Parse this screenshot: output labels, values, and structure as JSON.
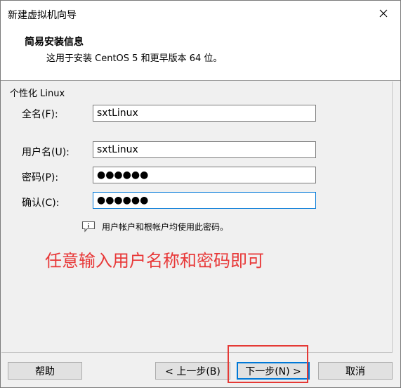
{
  "window": {
    "title": "新建虚拟机向导"
  },
  "header": {
    "title": "简易安装信息",
    "subtitle": "这用于安装 CentOS 5 和更早版本 64 位。"
  },
  "form": {
    "group_label": "个性化 Linux",
    "full_name": {
      "label": "全名(F):",
      "value": "sxtLinux"
    },
    "username": {
      "label": "用户名(U):",
      "value": "sxtLinux"
    },
    "password": {
      "label": "密码(P):",
      "value": "●●●●●●"
    },
    "confirm": {
      "label": "确认(C):",
      "value": "●●●●●●"
    },
    "hint": "用户帐户和根帐户均使用此密码。"
  },
  "annotation": "任意输入用户名称和密码即可",
  "buttons": {
    "help": "帮助",
    "back": "< 上一步(B)",
    "next": "下一步(N) >",
    "cancel": "取消"
  },
  "colors": {
    "accent": "#0078d7",
    "annotation": "#e83838",
    "highlight_box": "#e53935"
  }
}
